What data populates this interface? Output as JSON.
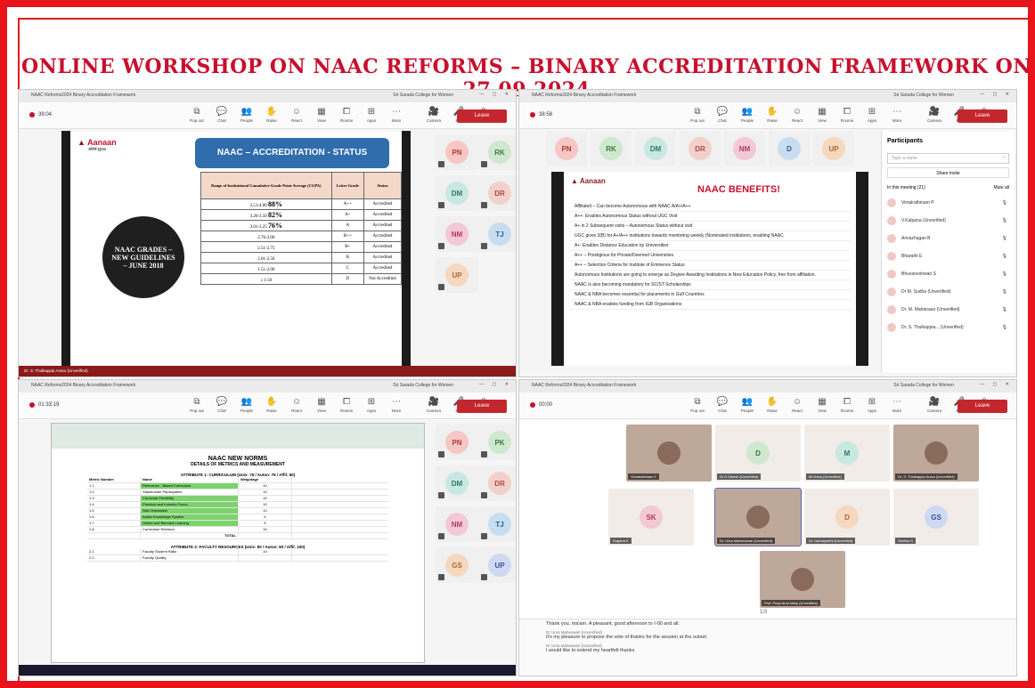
{
  "title": "ONLINE WORKSHOP ON NAAC REFORMS – BINARY ACCREDITATION FRAMEWORK ON 27.09.2024",
  "colors": {
    "frame": "#e8141c",
    "title": "#c8102e",
    "leave": "#c4262e"
  },
  "window_title": "NAAC Reforms2024 Binary Accreditation Framework",
  "window_org": "Sri Sarada College for Women",
  "toolbar": {
    "items": [
      "Pop out",
      "Chat",
      "People",
      "Raise",
      "React",
      "View",
      "Rooms",
      "Apps",
      "More",
      "Camera",
      "Mic",
      "Share"
    ],
    "leave": "Leave"
  },
  "panes": [
    {
      "timer": "39:04"
    },
    {
      "timer": "38:58"
    },
    {
      "timer": "01:33:19"
    },
    {
      "timer": "00:00"
    }
  ],
  "slide1": {
    "logo": "Aanaan",
    "logo_sub": "अनन:gna",
    "heading": "NAAC – ACCREDITATION - STATUS",
    "circle_text": "NAAC GRADES – NEW GUIDELINES – JUNE 2018",
    "columns": [
      "Range of Institutional Cumulative Grade Point Average (CGPA)",
      "Letter Grade",
      "Status"
    ],
    "rows": [
      {
        "range": "3.51-4.00",
        "pct": "88%",
        "grade": "A++",
        "status": "Accredited"
      },
      {
        "range": "3.26-3.50",
        "pct": "82%",
        "grade": "A+",
        "status": "Accredited"
      },
      {
        "range": "3.01-3.25",
        "pct": "76%",
        "grade": "A",
        "status": "Accredited"
      },
      {
        "range": "2.76-3.00",
        "pct": "",
        "grade": "B++",
        "status": "Accredited"
      },
      {
        "range": "2.51-2.75",
        "pct": "",
        "grade": "B+",
        "status": "Accredited"
      },
      {
        "range": "2.01-2.50",
        "pct": "",
        "grade": "B",
        "status": "Accredited"
      },
      {
        "range": "1.51-2.00",
        "pct": "",
        "grade": "C",
        "status": "Accredited"
      },
      {
        "range": "≤ 1.50",
        "pct": "",
        "grade": "D",
        "status": "Not Accredited"
      }
    ],
    "footer": "Dr. S. Thulkappia Arasu (Unverified)"
  },
  "gallery1": [
    "PN",
    "RK",
    "DM",
    "DR",
    "NM",
    "TJ",
    "UP"
  ],
  "page_indicator": "1/3",
  "slide2": {
    "heading": "NAAC BENEFITS!",
    "logo": "Aanaan",
    "items": [
      "Affiliated – Can become Autonomous with NAAC A/A+/A++",
      "A++: Enables Autonomous Status without UGC Visit",
      "A+ in 2 Subsequent visits – Autonomous Status without visit",
      "UGC gives 3(B) for A+/A++ institutions towards monitoring weekly (Nominated institutions, enabling NAAC",
      "A+: Enables Distance Education by Universities",
      "A++ – Prestigious for Private/Deemed Universities",
      "A++ – Selection Criteria for Institute of Eminence Status",
      "Autonomous Institutions are going to emerge as Degree Awarding Institutions in New Education Policy, free from affiliation.",
      "NAAC is also becoming mandatory for SC/ST Scholarships",
      "NAAC & NBA becomes essential for placements in Gulf Countries",
      "NAAC & NBA enables funding from IGB Organisations"
    ]
  },
  "strip2": [
    "PN",
    "RK",
    "DM",
    "DR",
    "NM",
    "D",
    "UP"
  ],
  "participants": {
    "title": "Participants",
    "search": "Type a name",
    "share": "Share invite",
    "section": "In this meeting (21)",
    "mute": "Mute all",
    "people": [
      "Vimalrathinam P",
      "V.Kalpana (Unverified)",
      "Arivazhagan B",
      "Bharathi E",
      "Bhuvaneshwari S",
      "Dr M. Sudha (Unverified)",
      "Dr. M. Mahanaan (Unverified)",
      "Dr. S. Thulkappia... (Unverified)"
    ]
  },
  "sheet": {
    "title": "NAAC NEW NORMS",
    "subtitle": "DETAILS OF METRICS AND MEASUREMENT",
    "section1": "ATTRIBUTE 1: CURRICULUM (Univ: 75 / Auton: 75 / Affil: 60)",
    "section2": "ATTRIBUTE 2: FACULTY RESOURCES (Univ: 90 / Auton: 90 / Affil: 100)",
    "headers": [
      "Metric Number",
      "Name",
      "Weightage"
    ],
    "rows": [
      {
        "a": "1.1",
        "name": "Relevance - Based Curriculum",
        "v": "10",
        "green": true
      },
      {
        "a": "1.2",
        "name": "Stakeholder Participation",
        "v": "10",
        "green": false
      },
      {
        "a": "1.3",
        "name": "Curricular Flexibility",
        "v": "10",
        "green": true
      },
      {
        "a": "1.4",
        "name": "Practical and Industry Focus",
        "v": "10",
        "green": true
      },
      {
        "a": "1.5",
        "name": "Skill Orientation",
        "v": "10",
        "green": true
      },
      {
        "a": "1.6",
        "name": "Indian Knowledge System",
        "v": "5",
        "green": true
      },
      {
        "a": "1.7",
        "name": "Online and Blended Learning",
        "v": "5",
        "green": true
      },
      {
        "a": "1.8",
        "name": "Curriculum Revision",
        "v": "10",
        "green": false
      }
    ],
    "total": "TOTAL",
    "rows2": [
      {
        "a": "2.1",
        "name": "Faculty Student Ratio",
        "v": "10"
      },
      {
        "a": "2.2",
        "name": "Faculty Quality",
        "v": ""
      }
    ]
  },
  "gallery3": [
    "PN",
    "PK",
    "DM",
    "DR",
    "NM",
    "TJ",
    "GS",
    "UP"
  ],
  "gallery4": [
    {
      "label": "Vimalrathinam T",
      "initial": ""
    },
    {
      "label": "Dr S Dinesh (Unverified)",
      "initial": "D"
    },
    {
      "label": "Mr.Usha (Unverified)",
      "initial": "M"
    },
    {
      "label": "Dr. S. Thulkappia Arasu (Unverified)",
      "initial": ""
    },
    {
      "label": "Sugana K",
      "initial": "SK"
    },
    {
      "label": "Dr. Uma Maheshwari (Unverified)",
      "initial": ""
    },
    {
      "label": "Dr. Damayanthi (Unverified)",
      "initial": "D"
    },
    {
      "label": "Geetha S",
      "initial": "GS"
    },
    {
      "label": "Prof. Priya Arun Mary (Unverified)",
      "initial": ""
    }
  ],
  "chat": [
    {
      "who": "",
      "text": "Thank you, ma'am. A pleasant, good afternoon to I-00 and all."
    },
    {
      "who": "Dr Uma Maheswari (Unverified)",
      "text": "It's my pleasure to propose the vote of thanks for the session at the outset."
    },
    {
      "who": "Dr Uma Maheswari (Unverified)",
      "text": "I would like to extend my heartfelt thanks"
    }
  ]
}
